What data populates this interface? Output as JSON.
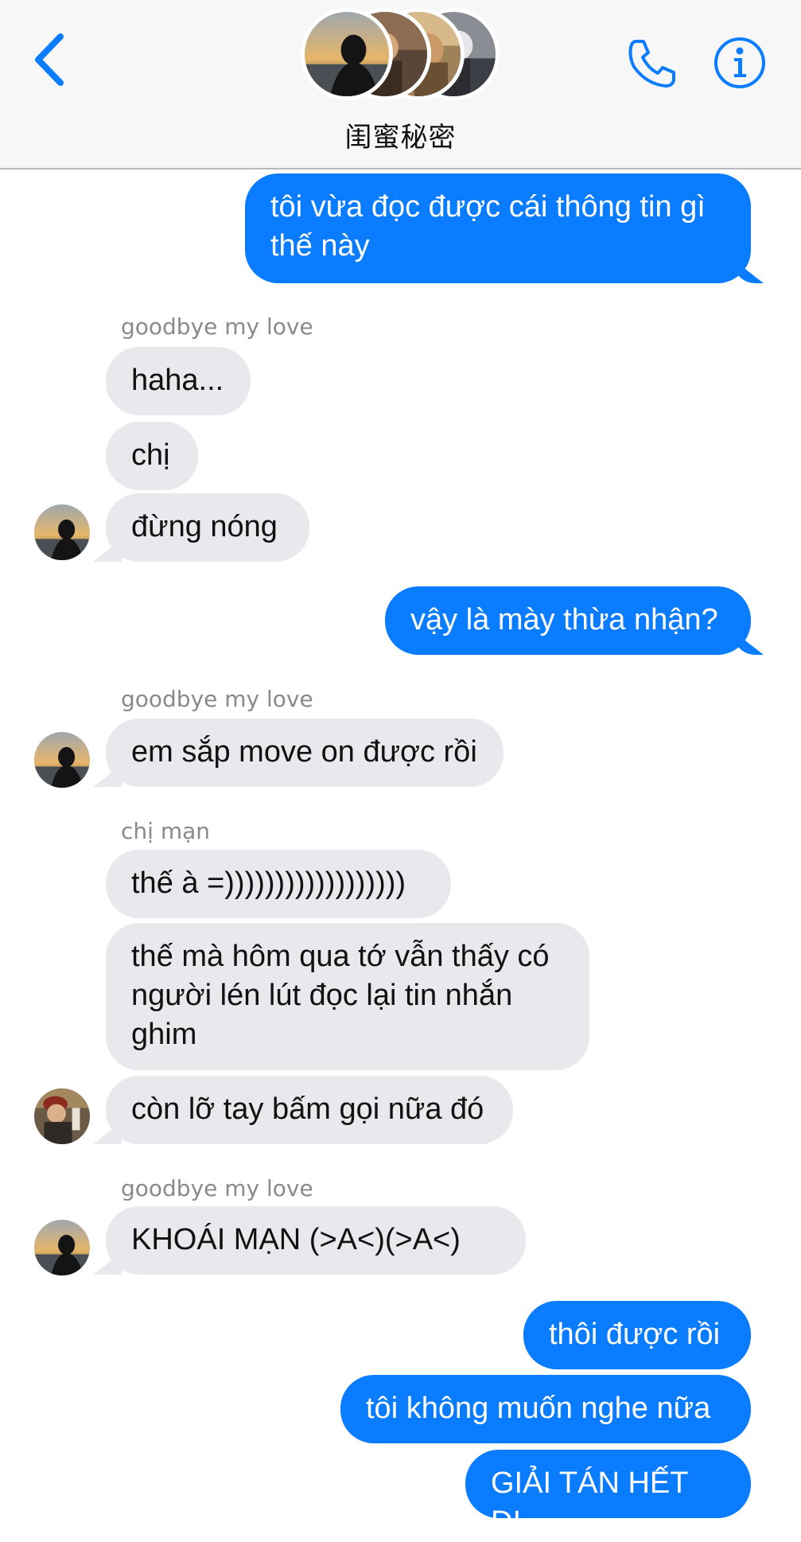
{
  "header": {
    "group_name": "闺蜜秘密",
    "back_icon": "chevron-left-icon",
    "call_icon": "phone-icon",
    "info_icon": "info-icon",
    "accent_color": "#0a7cff"
  },
  "messages": [
    {
      "side": "out",
      "text": "tôi vừa đọc được cái thông tin gì thế này"
    },
    {
      "side": "in",
      "sender": "goodbye my love",
      "text": "haha..."
    },
    {
      "side": "in",
      "text": "chị"
    },
    {
      "side": "in",
      "text": "đừng nóng"
    },
    {
      "side": "out",
      "text": "vậy là mày thừa nhận?"
    },
    {
      "side": "in",
      "sender": "goodbye my love",
      "text": "em sắp move on được rồi"
    },
    {
      "side": "in",
      "sender": "chị mạn",
      "text": "thế à =))))))))))))))))))"
    },
    {
      "side": "in",
      "text": "thế mà hôm qua tớ vẫn thấy có người lén lút đọc lại tin nhắn ghim"
    },
    {
      "side": "in",
      "text": "còn lỡ tay bấm gọi nữa đó"
    },
    {
      "side": "in",
      "sender": "goodbye my love",
      "text": "KHOÁI MẠN (>A<)(>A<)"
    },
    {
      "side": "out",
      "text": "thôi được rồi"
    },
    {
      "side": "out",
      "text": "tôi không muốn nghe nữa"
    },
    {
      "side": "out",
      "text": "GIẢI TÁN HẾT ĐI"
    }
  ]
}
